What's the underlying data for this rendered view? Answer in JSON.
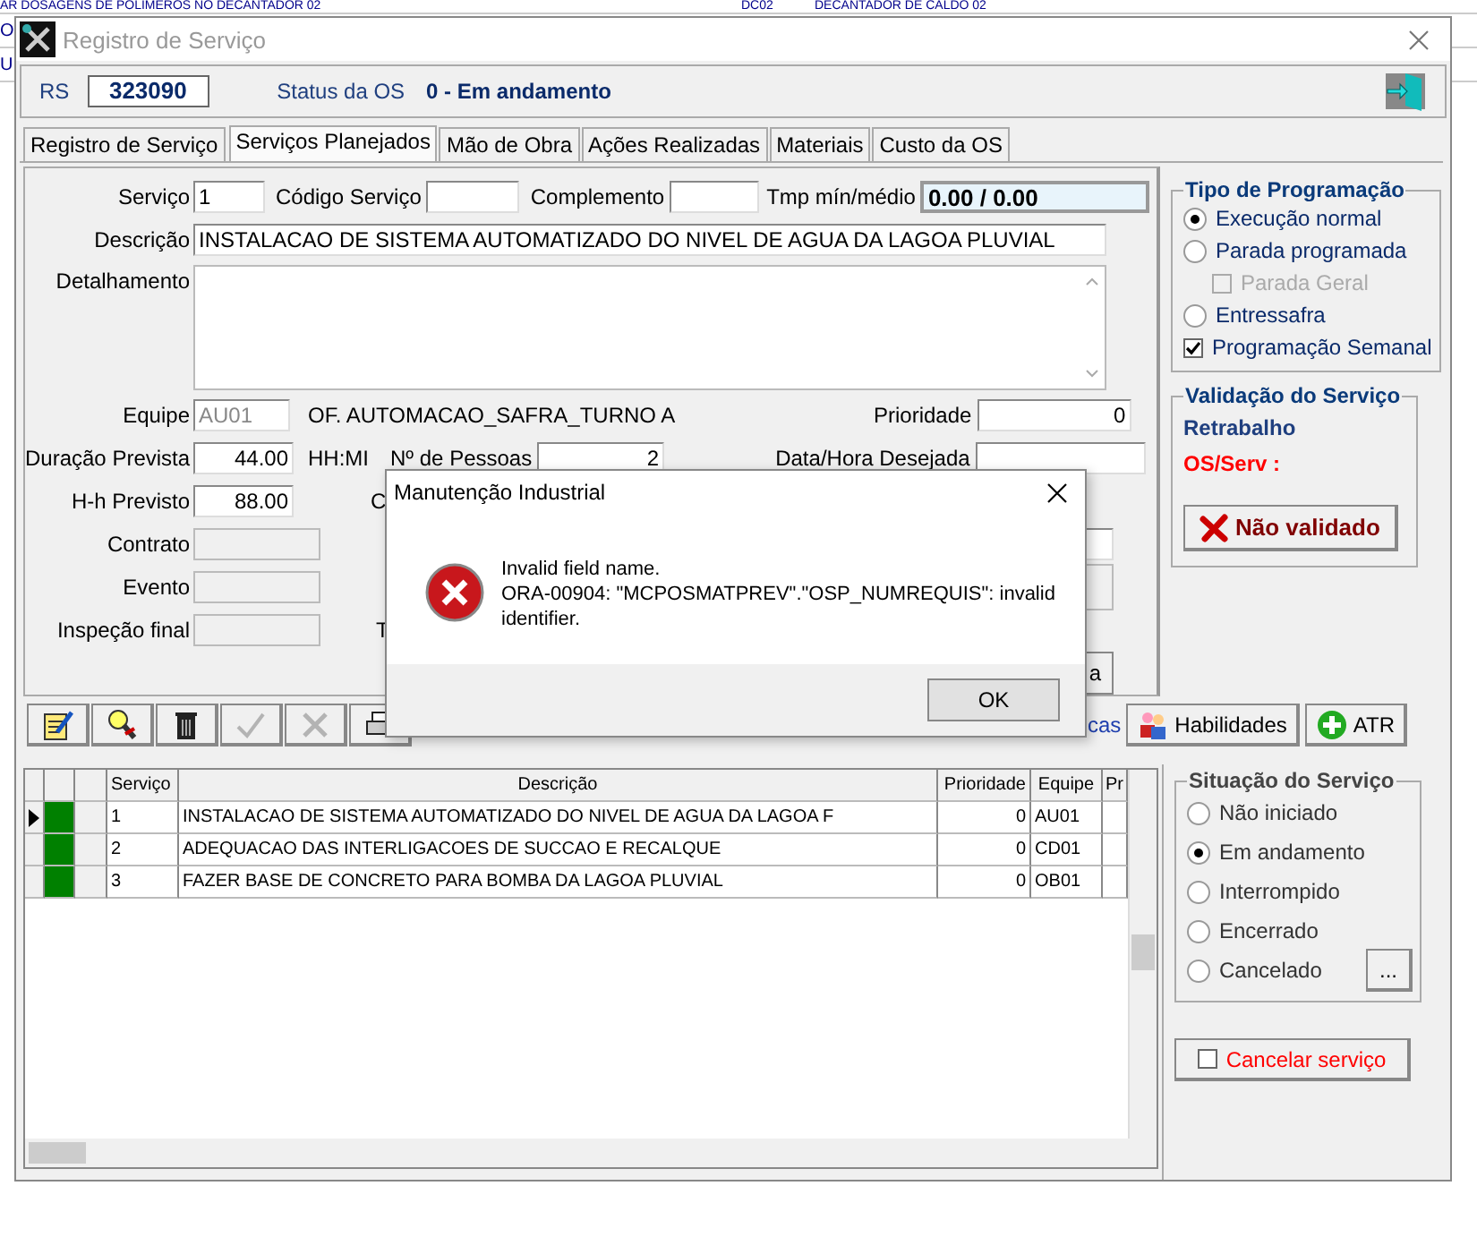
{
  "background_rows": [
    {
      "cells": [
        "AR DOSAGENS DE POLIMEROS NO DECANTADOR 02",
        "DC02",
        "DECANTADOR DE CALDO 02"
      ]
    },
    {
      "cells": [
        "O"
      ]
    },
    {
      "cells": [
        "U"
      ]
    }
  ],
  "window": {
    "title": "Registro de Serviço"
  },
  "header": {
    "rs_label": "RS",
    "rs_value": "323090",
    "status_label": "Status da OS",
    "status_value": "0 - Em andamento"
  },
  "tabs": [
    {
      "label": "Registro de Serviço",
      "selected": false
    },
    {
      "label": "Serviços Planejados",
      "selected": true
    },
    {
      "label": "Mão de Obra",
      "selected": false
    },
    {
      "label": "Ações Realizadas",
      "selected": false
    },
    {
      "label": "Materiais",
      "selected": false
    },
    {
      "label": "Custo da OS",
      "selected": false
    }
  ],
  "form": {
    "servico": {
      "label": "Serviço",
      "value": "1"
    },
    "codigo": {
      "label": "Código Serviço"
    },
    "complemento": {
      "label": "Complemento"
    },
    "tempo": {
      "label": "Tmp mín/médio",
      "value": "0.00 / 0.00"
    },
    "descricao": {
      "label": "Descrição",
      "value": "INSTALACAO DE SISTEMA AUTOMATIZADO DO NIVEL DE AGUA DA LAGOA PLUVIAL"
    },
    "detalhamento": {
      "label": "Detalhamento"
    },
    "equipe": {
      "label": "Equipe",
      "value": "AU01",
      "name": "OF. AUTOMACAO_SAFRA_TURNO A",
      "disabled": true
    },
    "prioridade": {
      "label": "Prioridade",
      "value": "0"
    },
    "duracao": {
      "label": "Duração Prevista",
      "value": "44.00",
      "unit": "HH:MI"
    },
    "pessoas": {
      "label": "Nº de Pessoas",
      "value": "2"
    },
    "data_hora": {
      "label": "Data/Hora Desejada"
    },
    "hh": {
      "label": "H-h Previsto",
      "value": "88.00",
      "hidden_label": "C"
    },
    "contrato": {
      "label": "Contrato"
    },
    "evento": {
      "label": "Evento"
    },
    "inspecao": {
      "label": "Inspeção final",
      "hidden_label": "T"
    },
    "hidden_button": "a"
  },
  "tipo_programacao": {
    "title": "Tipo de Programação",
    "options": [
      {
        "kind": "radio",
        "label": "Execução normal",
        "selected": true,
        "disabled": false
      },
      {
        "kind": "radio",
        "label": "Parada programada",
        "selected": false,
        "disabled": false,
        "children": [
          {
            "kind": "checkbox",
            "label": "Parada Geral",
            "checked": false,
            "disabled": true
          }
        ]
      },
      {
        "kind": "radio",
        "label": "Entressafra",
        "selected": false,
        "disabled": false
      },
      {
        "kind": "checkbox",
        "label": "Programação Semanal",
        "checked": true,
        "disabled": false
      }
    ]
  },
  "validacao": {
    "title": "Validação do Serviço",
    "retrabalho": "Retrabalho",
    "os_serv": "OS/Serv :",
    "button": "Não validado"
  },
  "toolbar": {
    "icon_buttons": [
      {
        "kind": "edit",
        "disabled": false
      },
      {
        "kind": "find",
        "disabled": false
      },
      {
        "kind": "delete",
        "disabled": false
      },
      {
        "kind": "confirm",
        "disabled": true
      },
      {
        "kind": "cancel",
        "disabled": true
      },
      {
        "kind": "print",
        "disabled": false
      }
    ],
    "link_fragment": "cas",
    "buttons": [
      {
        "kind": "people",
        "label": "Habilidades"
      },
      {
        "kind": "plus",
        "label": "ATR"
      }
    ]
  },
  "grid": {
    "columns": [
      "Serviço",
      "Descrição",
      "Prioridade",
      "Equipe",
      "Pr"
    ],
    "rows": [
      {
        "servico": "1",
        "descricao": "INSTALACAO DE SISTEMA AUTOMATIZADO DO NIVEL DE AGUA DA LAGOA F",
        "prioridade": "0",
        "equipe": "AU01",
        "selected": true,
        "color": "#008000"
      },
      {
        "servico": "2",
        "descricao": "ADEQUACAO DAS INTERLIGACOES DE SUCCAO E RECALQUE",
        "prioridade": "0",
        "equipe": "CD01",
        "selected": false,
        "color": "#008000"
      },
      {
        "servico": "3",
        "descricao": "FAZER BASE DE CONCRETO PARA BOMBA DA LAGOA PLUVIAL",
        "prioridade": "0",
        "equipe": "OB01",
        "selected": false,
        "color": "#008000"
      }
    ]
  },
  "situacao": {
    "title": "Situação do Serviço",
    "options": [
      {
        "label": "Não iniciado",
        "selected": false
      },
      {
        "label": "Em andamento",
        "selected": true
      },
      {
        "label": "Interrompido",
        "selected": false
      },
      {
        "label": "Encerrado",
        "selected": false
      },
      {
        "label": "Cancelado",
        "selected": false
      }
    ],
    "more_button": "..."
  },
  "cancelar": {
    "label": "Cancelar serviço",
    "checked": false
  },
  "dialog": {
    "title": "Manutenção Industrial",
    "message": [
      "Invalid field name.",
      "ORA-00904: \"MCPOSMATPREV\".\"OSP_NUMREQUIS\": invalid identifier."
    ],
    "button": "OK"
  }
}
